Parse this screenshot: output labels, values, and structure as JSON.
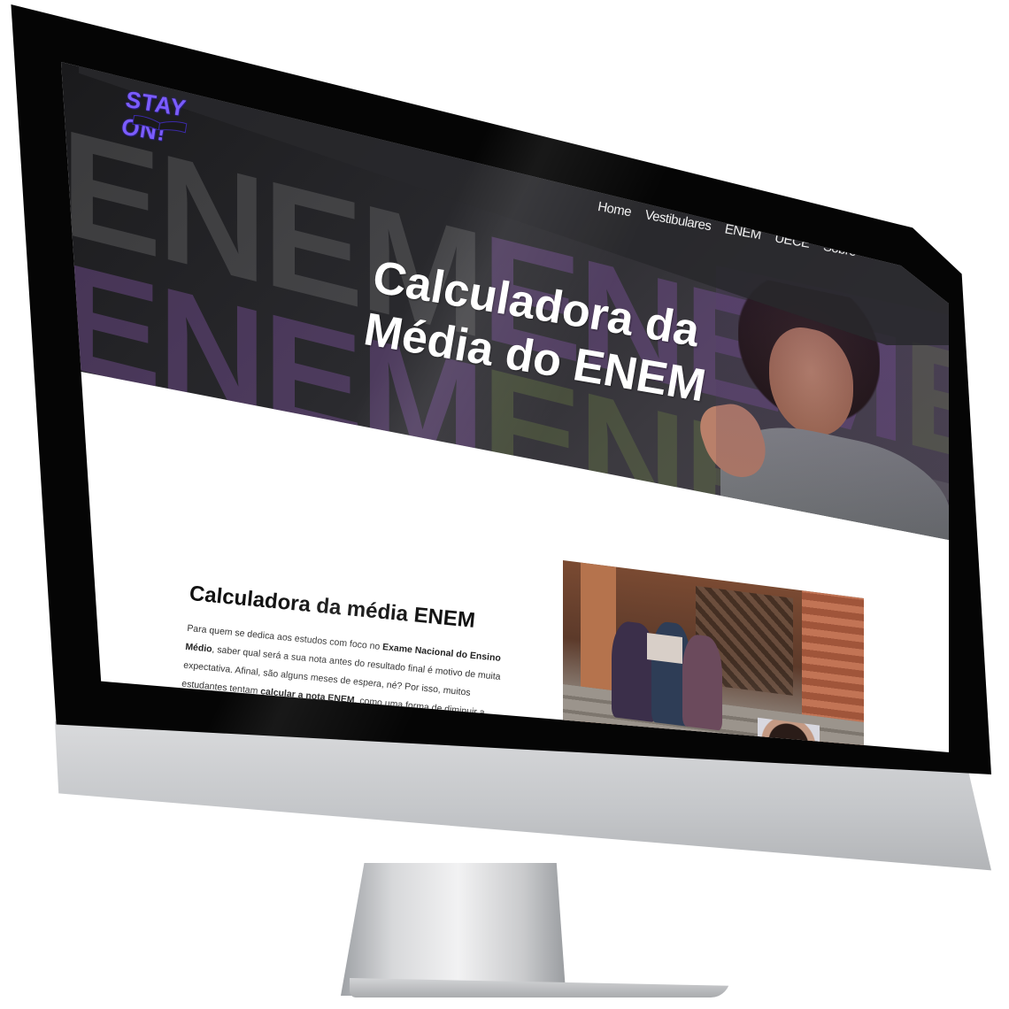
{
  "brand": {
    "logo_text": "STAY ON!",
    "logo_icon": "open-book-icon",
    "logo_color": "#7b5cff"
  },
  "nav": {
    "items": [
      {
        "label": "Home"
      },
      {
        "label": "Vestibulares"
      },
      {
        "label": "ENEM"
      },
      {
        "label": "UECE"
      },
      {
        "label": "Sobre"
      }
    ]
  },
  "hero": {
    "title_line1": "Calculadora da",
    "title_line2": "Média do ENEM",
    "background_letters": "ENEM"
  },
  "section": {
    "title": "Calculadora da média ENEM",
    "p1_a": "Para quem se dedica aos estudos com foco no ",
    "p1_b": "Exame Nacional do Ensino Médio",
    "p1_c": ", saber qual será a sua nota antes do resultado final é motivo de muita expectativa. Afinal, são alguns meses de espera, né? Por isso, muitos estudantes tentam ",
    "p1_d": "calcular a nota ENEM",
    "p1_e": ", como uma forma de diminuir a"
  },
  "colors": {
    "hero_bg": "#2a2a2e",
    "accent_purple": "#7b5cff",
    "bezel": "#050505"
  }
}
